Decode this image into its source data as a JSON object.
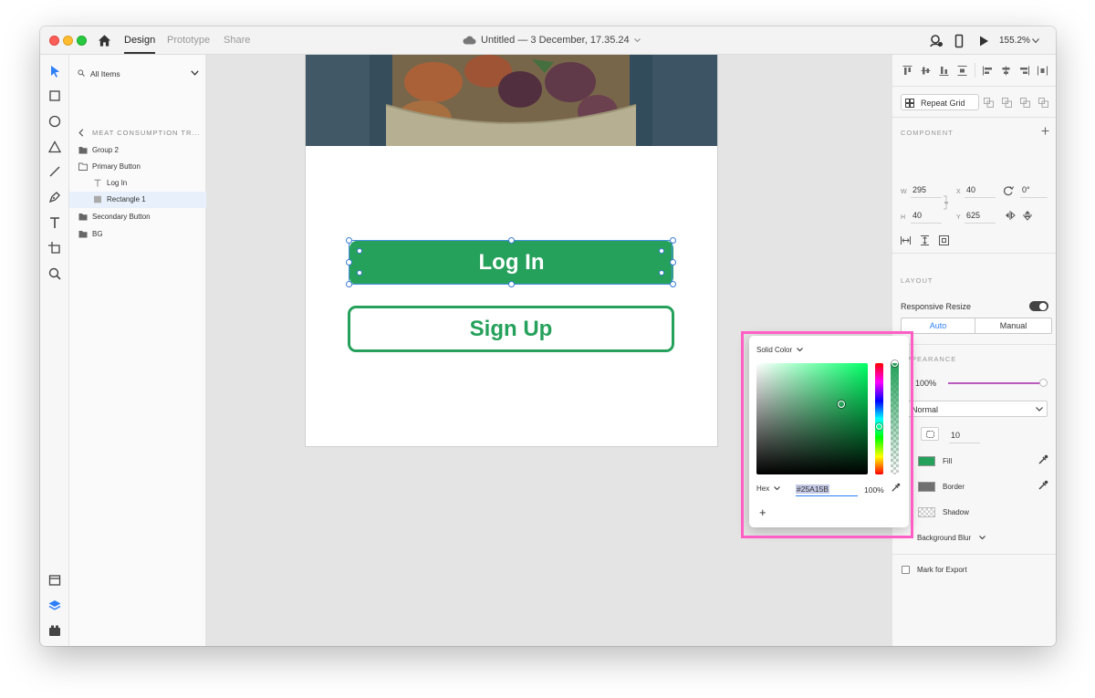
{
  "titlebar": {
    "tabs": [
      "Design",
      "Prototype",
      "Share"
    ],
    "doc_title": "Untitled — 3 December, 17.35.24",
    "zoom": "155.2%"
  },
  "layers": {
    "filter_label": "All Items",
    "breadcrumb": "MEAT CONSUMPTION TR...",
    "items": [
      "Group 2",
      "Primary Button",
      "Log In",
      "Rectangle 1",
      "Secondary Button",
      "BG"
    ]
  },
  "artboard": {
    "primary_label": "Log In",
    "secondary_label": "Sign Up"
  },
  "inspector": {
    "repeat_grid": "Repeat Grid",
    "component_title": "COMPONENT",
    "w_label": "W",
    "w_value": "295",
    "x_label": "X",
    "x_value": "40",
    "rotation": "0°",
    "h_label": "H",
    "h_value": "40",
    "y_label": "Y",
    "y_value": "625",
    "layout_title": "LAYOUT",
    "responsive_resize": "Responsive Resize",
    "auto": "Auto",
    "manual": "Manual",
    "appearance_title": "APPEARANCE",
    "opacity": "100%",
    "blend": "Normal",
    "radius": "10",
    "fill": "Fill",
    "border": "Border",
    "shadow": "Shadow",
    "background_blur": "Background Blur",
    "mark_export": "Mark for Export"
  },
  "picker": {
    "mode": "Solid Color",
    "format": "Hex",
    "hex": "#25A15B",
    "alpha": "100%",
    "add": "+"
  },
  "colors": {
    "accent_green": "#25a15b",
    "highlight_pink": "#ff5ec4",
    "selection_blue": "#4a90e2"
  }
}
